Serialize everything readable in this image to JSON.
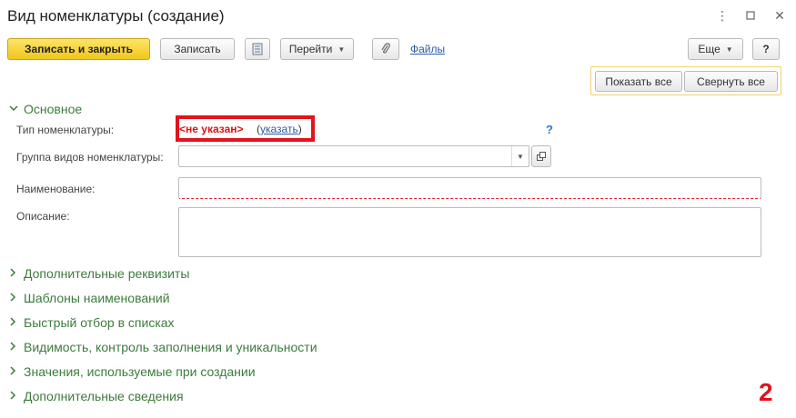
{
  "window": {
    "title": "Вид номенклатуры (создание)",
    "controls": [
      "more-vert-icon",
      "maximize-icon",
      "close-icon"
    ]
  },
  "toolbar": {
    "save_close": "Записать и закрыть",
    "save": "Записать",
    "report_icon": "document-list-icon",
    "goto": "Перейти",
    "attach_icon": "paperclip-icon",
    "files": "Файлы",
    "more": "Еще",
    "help": "?"
  },
  "group_controls": {
    "show_all": "Показать все",
    "collapse_all": "Свернуть все"
  },
  "main_section": {
    "title": "Основное",
    "fields": {
      "type_label": "Тип номенклатуры:",
      "type_value": "<не указан>",
      "type_action": "указать",
      "type_help": "?",
      "group_label": "Группа видов номенклатуры:",
      "group_value": "",
      "name_label": "Наименование:",
      "name_value": "",
      "description_label": "Описание:",
      "description_value": ""
    }
  },
  "collapsed_sections": [
    "Дополнительные реквизиты",
    "Шаблоны наименований",
    "Быстрый отбор в списках",
    "Видимость, контроль заполнения и уникальности",
    "Значения, используемые при создании",
    "Дополнительные сведения"
  ],
  "annotation_number": "2",
  "colors": {
    "accent_green": "#3c7c3c",
    "primary_button": "#f2c61a",
    "highlight_red": "#e3121c",
    "link_blue": "#2a5aa8"
  }
}
